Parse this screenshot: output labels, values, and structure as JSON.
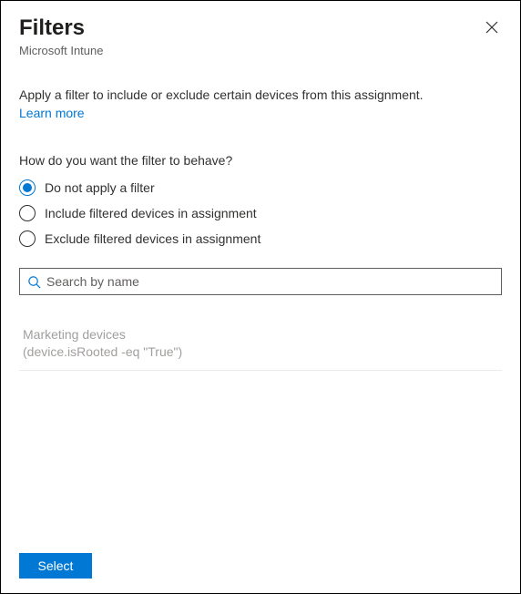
{
  "header": {
    "title": "Filters",
    "subtitle": "Microsoft Intune"
  },
  "description": "Apply a filter to include or exclude certain devices from this assignment.",
  "learn_more": "Learn more",
  "behavior_prompt": "How do you want the filter to behave?",
  "radios": {
    "opt0": "Do not apply a filter",
    "opt1": "Include filtered devices in assignment",
    "opt2": "Exclude filtered devices in assignment"
  },
  "search": {
    "placeholder": "Search by name"
  },
  "filters": {
    "item0": {
      "name": "Marketing devices",
      "rule": "(device.isRooted -eq \"True\")"
    }
  },
  "footer": {
    "select_label": "Select"
  }
}
